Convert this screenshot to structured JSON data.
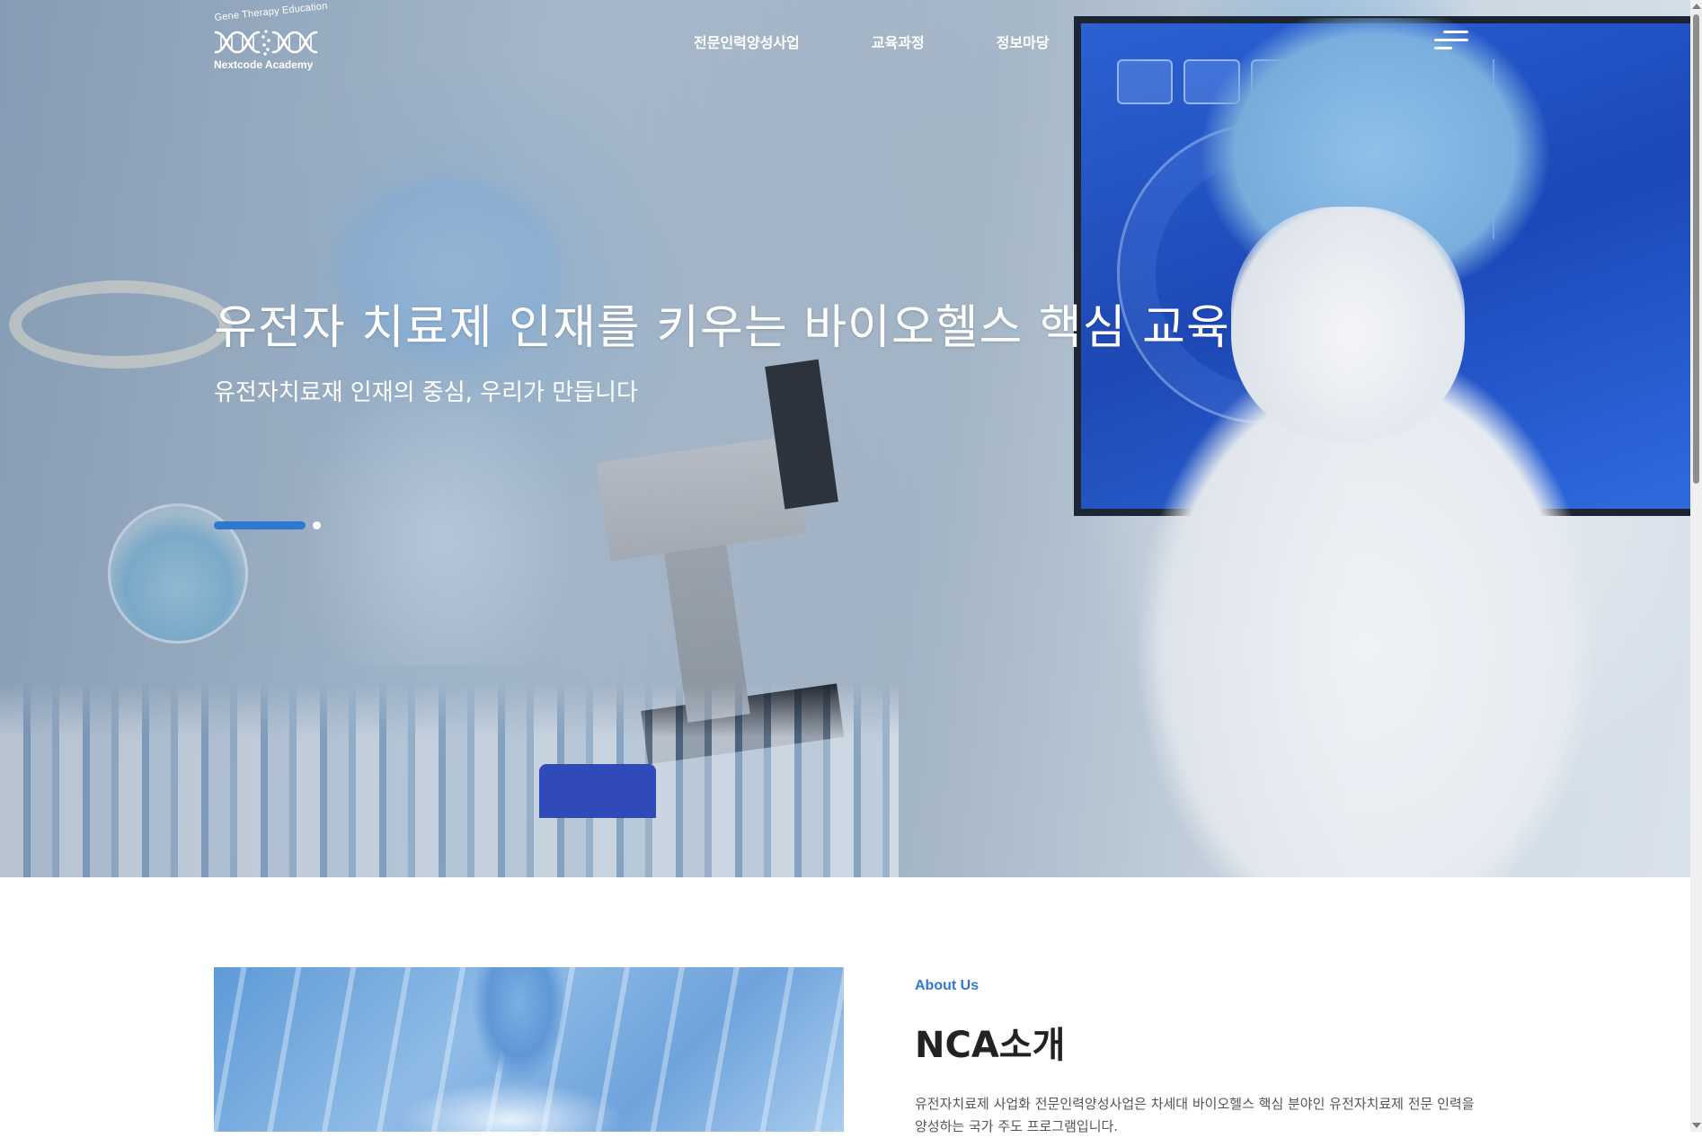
{
  "brand": {
    "arc_text": "Gene Therapy Education",
    "name": "Nextcode Academy"
  },
  "nav": {
    "items": [
      {
        "label": "전문인력양성사업"
      },
      {
        "label": "교육과정"
      },
      {
        "label": "정보마당"
      }
    ]
  },
  "hero": {
    "title": "유전자 치료제 인재를 키우는 바이오헬스 핵심 교육",
    "subtitle": "유전자치료재 인재의 중심, 우리가 만듭니다",
    "slider": {
      "total_slides": 2,
      "active_index": 1
    }
  },
  "about": {
    "eyebrow": "About Us",
    "title": "NCA소개",
    "description": "유전자치료제 사업화 전문인력양성사업은 차세대 바이오헬스 핵심 분야인 유전자치료제 전문 인력을 양성하는 국가 주도 프로그램입니다."
  },
  "icons": {
    "menu": "hamburger-menu-icon",
    "logo": "dna-helix-logo-icon"
  },
  "colors": {
    "accent": "#2f78d0",
    "heading": "#222222",
    "body_text": "#555555",
    "nav_text": "#ffffff"
  }
}
